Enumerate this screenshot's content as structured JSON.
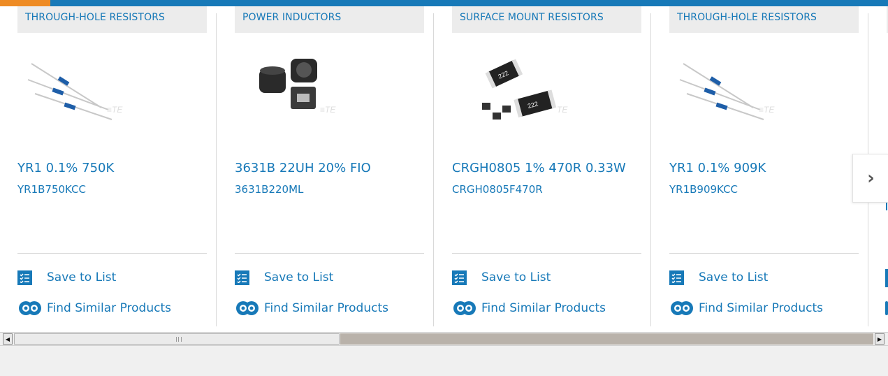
{
  "colors": {
    "accent": "#1779b8",
    "top_accent": "#ee8b24",
    "category_bg": "#ececec"
  },
  "cards": [
    {
      "category": "THROUGH-HOLE RESISTORS",
      "title": "YR1 0.1% 750K",
      "part_number": "YR1B750KCC",
      "image": "through-hole-resistor-image",
      "save_label": "Save to List",
      "find_label": "Find Similar Products"
    },
    {
      "category": "POWER INDUCTORS",
      "title": "3631B 22UH 20% FIO",
      "part_number": "3631B220ML",
      "image": "power-inductor-image",
      "save_label": "Save to List",
      "find_label": "Find Similar Products"
    },
    {
      "category": "SURFACE MOUNT RESISTORS",
      "title": "CRGH0805 1% 470R 0.33W",
      "part_number": "CRGH0805F470R",
      "image": "surface-mount-resistor-image",
      "save_label": "Save to List",
      "find_label": "Find Similar Products"
    },
    {
      "category": "THROUGH-HOLE RESISTORS",
      "title": "YR1 0.1% 909K",
      "part_number": "YR1B909KCC",
      "image": "through-hole-resistor-image",
      "save_label": "Save to List",
      "find_label": "Find Similar Products"
    }
  ],
  "next_button": {
    "icon": "chevron-right-icon",
    "glyph": "›"
  },
  "scrollbar": {
    "left_arrow": "◀",
    "right_arrow": "▶"
  }
}
